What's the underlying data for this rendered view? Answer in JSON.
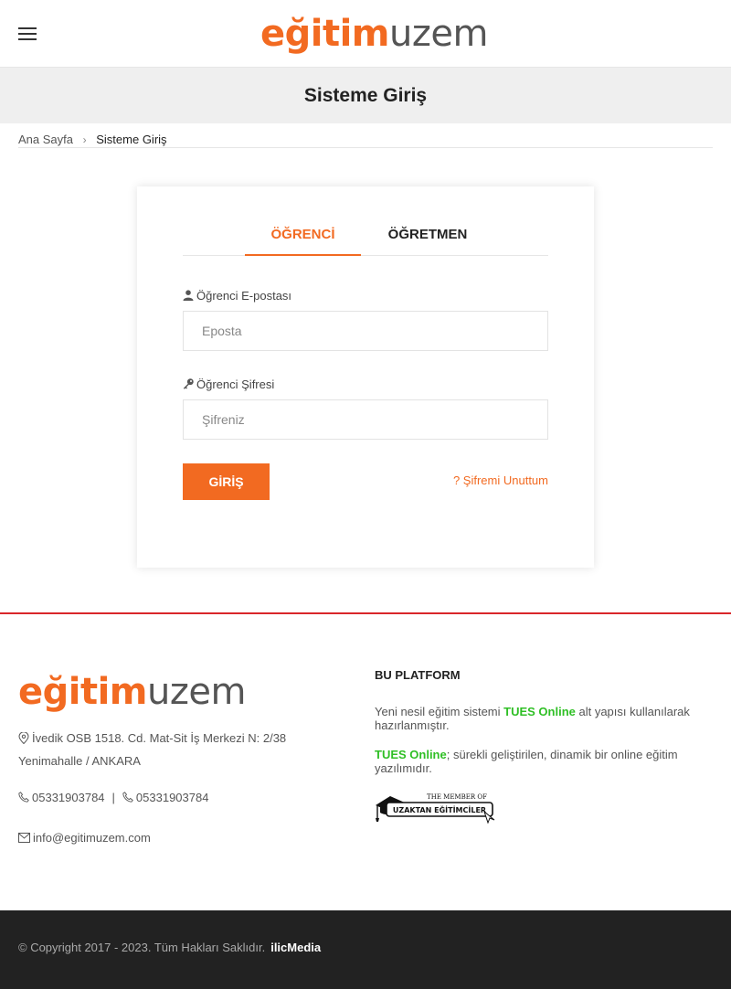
{
  "header": {
    "logo": {
      "part1": "eğitim",
      "part2": "uzem"
    },
    "menu_icon": "hamburger-icon"
  },
  "page_title": "Sisteme Giriş",
  "breadcrumb": {
    "home": "Ana Sayfa",
    "current": "Sisteme Giriş"
  },
  "login": {
    "tabs": [
      "ÖĞRENCİ",
      "ÖĞRETMEN"
    ],
    "active_tab": "ÖĞRENCİ",
    "email_label": "Öğrenci E-postası",
    "email_placeholder": "Eposta",
    "email_value": "",
    "password_label": "Öğrenci Şifresi",
    "password_placeholder": "Şifreniz",
    "password_value": "",
    "submit_label": "GİRİŞ",
    "forgot_label": "? Şifremi Unuttum"
  },
  "footer": {
    "logo": {
      "part1": "eğitim",
      "part2": "uzem"
    },
    "address": "İvedik OSB 1518. Cd. Mat-Sit İş Merkezi N: 2/38 Yenimahalle / ANKARA",
    "phone1": "05331903784",
    "phone_divider": "|",
    "phone2": "05331903784",
    "email": "info@egitimuzem.com",
    "platform_title": "BU PLATFORM",
    "platform_line1_pre": "Yeni nesil eğitim sistemi ",
    "platform_line1_brand": "TUES Online",
    "platform_line1_post": " alt yapısı kullanılarak hazırlanmıştır.",
    "platform_line2_brand": "TUES Online",
    "platform_line2_post": "; sürekli geliştirilen, dinamik bir online eğitim yazılımıdır.",
    "member_badge": {
      "top": "THE MEMBER OF",
      "bottom": "UZAKTAN EĞİTİMCİLER"
    }
  },
  "bottom_bar": {
    "copyright": "© Copyright 2017 - 2023. Tüm Hakları Saklıdır.",
    "brand": "ilicMedia"
  },
  "colors": {
    "accent": "#f26a21",
    "footer_divider": "#d9262a",
    "highlight_green": "#2fbf25",
    "bottom_bar": "#222222"
  }
}
